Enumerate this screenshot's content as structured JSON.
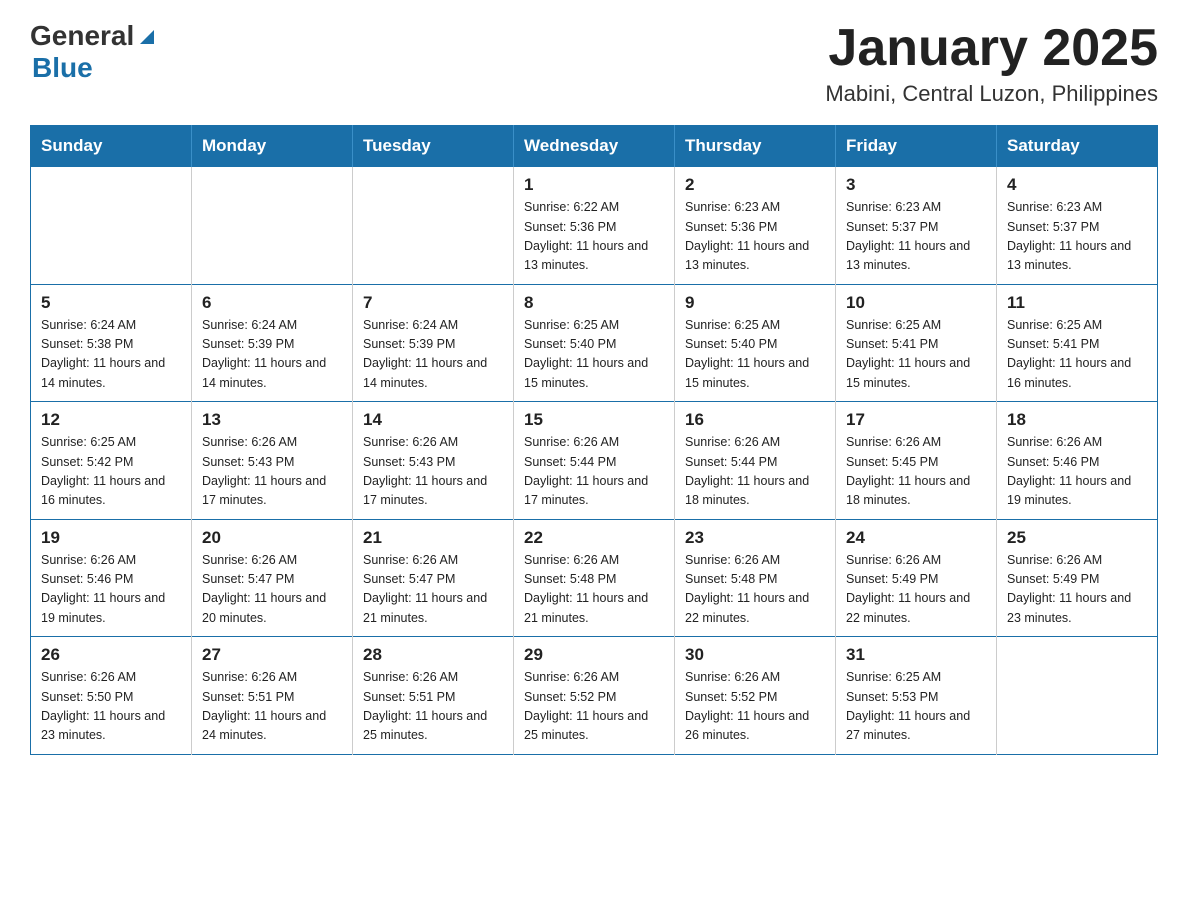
{
  "header": {
    "logo_general": "General",
    "logo_blue": "Blue",
    "month_title": "January 2025",
    "location": "Mabini, Central Luzon, Philippines"
  },
  "weekdays": [
    "Sunday",
    "Monday",
    "Tuesday",
    "Wednesday",
    "Thursday",
    "Friday",
    "Saturday"
  ],
  "weeks": [
    [
      {
        "day": "",
        "info": ""
      },
      {
        "day": "",
        "info": ""
      },
      {
        "day": "",
        "info": ""
      },
      {
        "day": "1",
        "info": "Sunrise: 6:22 AM\nSunset: 5:36 PM\nDaylight: 11 hours\nand 13 minutes."
      },
      {
        "day": "2",
        "info": "Sunrise: 6:23 AM\nSunset: 5:36 PM\nDaylight: 11 hours\nand 13 minutes."
      },
      {
        "day": "3",
        "info": "Sunrise: 6:23 AM\nSunset: 5:37 PM\nDaylight: 11 hours\nand 13 minutes."
      },
      {
        "day": "4",
        "info": "Sunrise: 6:23 AM\nSunset: 5:37 PM\nDaylight: 11 hours\nand 13 minutes."
      }
    ],
    [
      {
        "day": "5",
        "info": "Sunrise: 6:24 AM\nSunset: 5:38 PM\nDaylight: 11 hours\nand 14 minutes."
      },
      {
        "day": "6",
        "info": "Sunrise: 6:24 AM\nSunset: 5:39 PM\nDaylight: 11 hours\nand 14 minutes."
      },
      {
        "day": "7",
        "info": "Sunrise: 6:24 AM\nSunset: 5:39 PM\nDaylight: 11 hours\nand 14 minutes."
      },
      {
        "day": "8",
        "info": "Sunrise: 6:25 AM\nSunset: 5:40 PM\nDaylight: 11 hours\nand 15 minutes."
      },
      {
        "day": "9",
        "info": "Sunrise: 6:25 AM\nSunset: 5:40 PM\nDaylight: 11 hours\nand 15 minutes."
      },
      {
        "day": "10",
        "info": "Sunrise: 6:25 AM\nSunset: 5:41 PM\nDaylight: 11 hours\nand 15 minutes."
      },
      {
        "day": "11",
        "info": "Sunrise: 6:25 AM\nSunset: 5:41 PM\nDaylight: 11 hours\nand 16 minutes."
      }
    ],
    [
      {
        "day": "12",
        "info": "Sunrise: 6:25 AM\nSunset: 5:42 PM\nDaylight: 11 hours\nand 16 minutes."
      },
      {
        "day": "13",
        "info": "Sunrise: 6:26 AM\nSunset: 5:43 PM\nDaylight: 11 hours\nand 17 minutes."
      },
      {
        "day": "14",
        "info": "Sunrise: 6:26 AM\nSunset: 5:43 PM\nDaylight: 11 hours\nand 17 minutes."
      },
      {
        "day": "15",
        "info": "Sunrise: 6:26 AM\nSunset: 5:44 PM\nDaylight: 11 hours\nand 17 minutes."
      },
      {
        "day": "16",
        "info": "Sunrise: 6:26 AM\nSunset: 5:44 PM\nDaylight: 11 hours\nand 18 minutes."
      },
      {
        "day": "17",
        "info": "Sunrise: 6:26 AM\nSunset: 5:45 PM\nDaylight: 11 hours\nand 18 minutes."
      },
      {
        "day": "18",
        "info": "Sunrise: 6:26 AM\nSunset: 5:46 PM\nDaylight: 11 hours\nand 19 minutes."
      }
    ],
    [
      {
        "day": "19",
        "info": "Sunrise: 6:26 AM\nSunset: 5:46 PM\nDaylight: 11 hours\nand 19 minutes."
      },
      {
        "day": "20",
        "info": "Sunrise: 6:26 AM\nSunset: 5:47 PM\nDaylight: 11 hours\nand 20 minutes."
      },
      {
        "day": "21",
        "info": "Sunrise: 6:26 AM\nSunset: 5:47 PM\nDaylight: 11 hours\nand 21 minutes."
      },
      {
        "day": "22",
        "info": "Sunrise: 6:26 AM\nSunset: 5:48 PM\nDaylight: 11 hours\nand 21 minutes."
      },
      {
        "day": "23",
        "info": "Sunrise: 6:26 AM\nSunset: 5:48 PM\nDaylight: 11 hours\nand 22 minutes."
      },
      {
        "day": "24",
        "info": "Sunrise: 6:26 AM\nSunset: 5:49 PM\nDaylight: 11 hours\nand 22 minutes."
      },
      {
        "day": "25",
        "info": "Sunrise: 6:26 AM\nSunset: 5:49 PM\nDaylight: 11 hours\nand 23 minutes."
      }
    ],
    [
      {
        "day": "26",
        "info": "Sunrise: 6:26 AM\nSunset: 5:50 PM\nDaylight: 11 hours\nand 23 minutes."
      },
      {
        "day": "27",
        "info": "Sunrise: 6:26 AM\nSunset: 5:51 PM\nDaylight: 11 hours\nand 24 minutes."
      },
      {
        "day": "28",
        "info": "Sunrise: 6:26 AM\nSunset: 5:51 PM\nDaylight: 11 hours\nand 25 minutes."
      },
      {
        "day": "29",
        "info": "Sunrise: 6:26 AM\nSunset: 5:52 PM\nDaylight: 11 hours\nand 25 minutes."
      },
      {
        "day": "30",
        "info": "Sunrise: 6:26 AM\nSunset: 5:52 PM\nDaylight: 11 hours\nand 26 minutes."
      },
      {
        "day": "31",
        "info": "Sunrise: 6:25 AM\nSunset: 5:53 PM\nDaylight: 11 hours\nand 27 minutes."
      },
      {
        "day": "",
        "info": ""
      }
    ]
  ]
}
